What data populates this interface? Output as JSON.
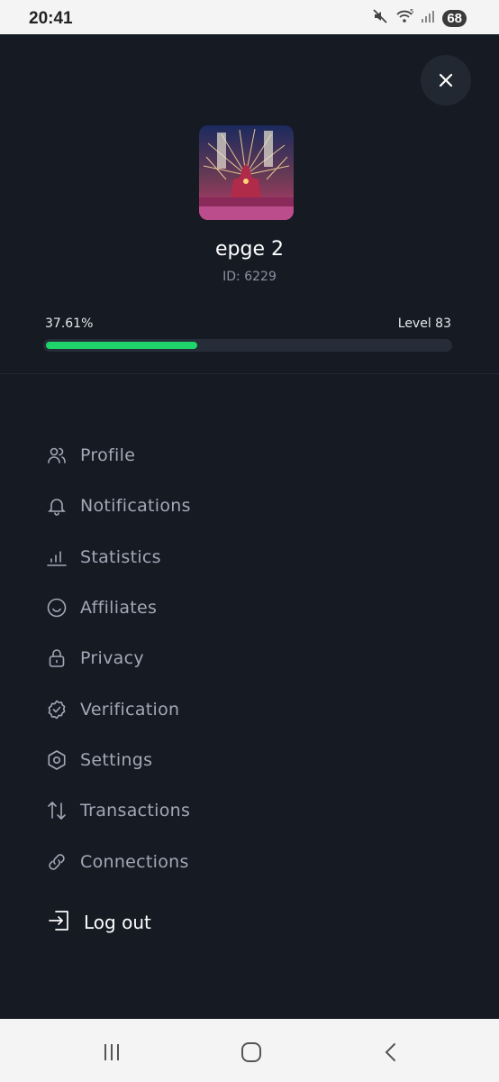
{
  "status_bar": {
    "time": "20:41",
    "battery": "68",
    "icons": [
      "mute-icon",
      "wifi-icon",
      "signal-icon",
      "battery-icon"
    ]
  },
  "profile": {
    "username": "epge 2",
    "user_id": "ID: 6229",
    "progress_text": "37.61%",
    "progress_value": 0.3761,
    "level": "Level 83",
    "avatar": "fireworks-castle-avatar"
  },
  "menu": {
    "items": [
      {
        "label": "Profile",
        "icon": "users-icon"
      },
      {
        "label": "Notifications",
        "icon": "bell-icon"
      },
      {
        "label": "Statistics",
        "icon": "bar-chart-icon"
      },
      {
        "label": "Affiliates",
        "icon": "smile-icon"
      },
      {
        "label": "Privacy",
        "icon": "lock-icon"
      },
      {
        "label": "Verification",
        "icon": "badge-check-icon"
      },
      {
        "label": "Settings",
        "icon": "settings-hexagon-icon"
      },
      {
        "label": "Transactions",
        "icon": "arrows-updown-icon"
      },
      {
        "label": "Connections",
        "icon": "link-icon"
      }
    ],
    "logout_label": "Log out"
  },
  "colors": {
    "background": "#151a23",
    "progress": "#1fd46b",
    "menu_text": "#a2a9b6"
  }
}
